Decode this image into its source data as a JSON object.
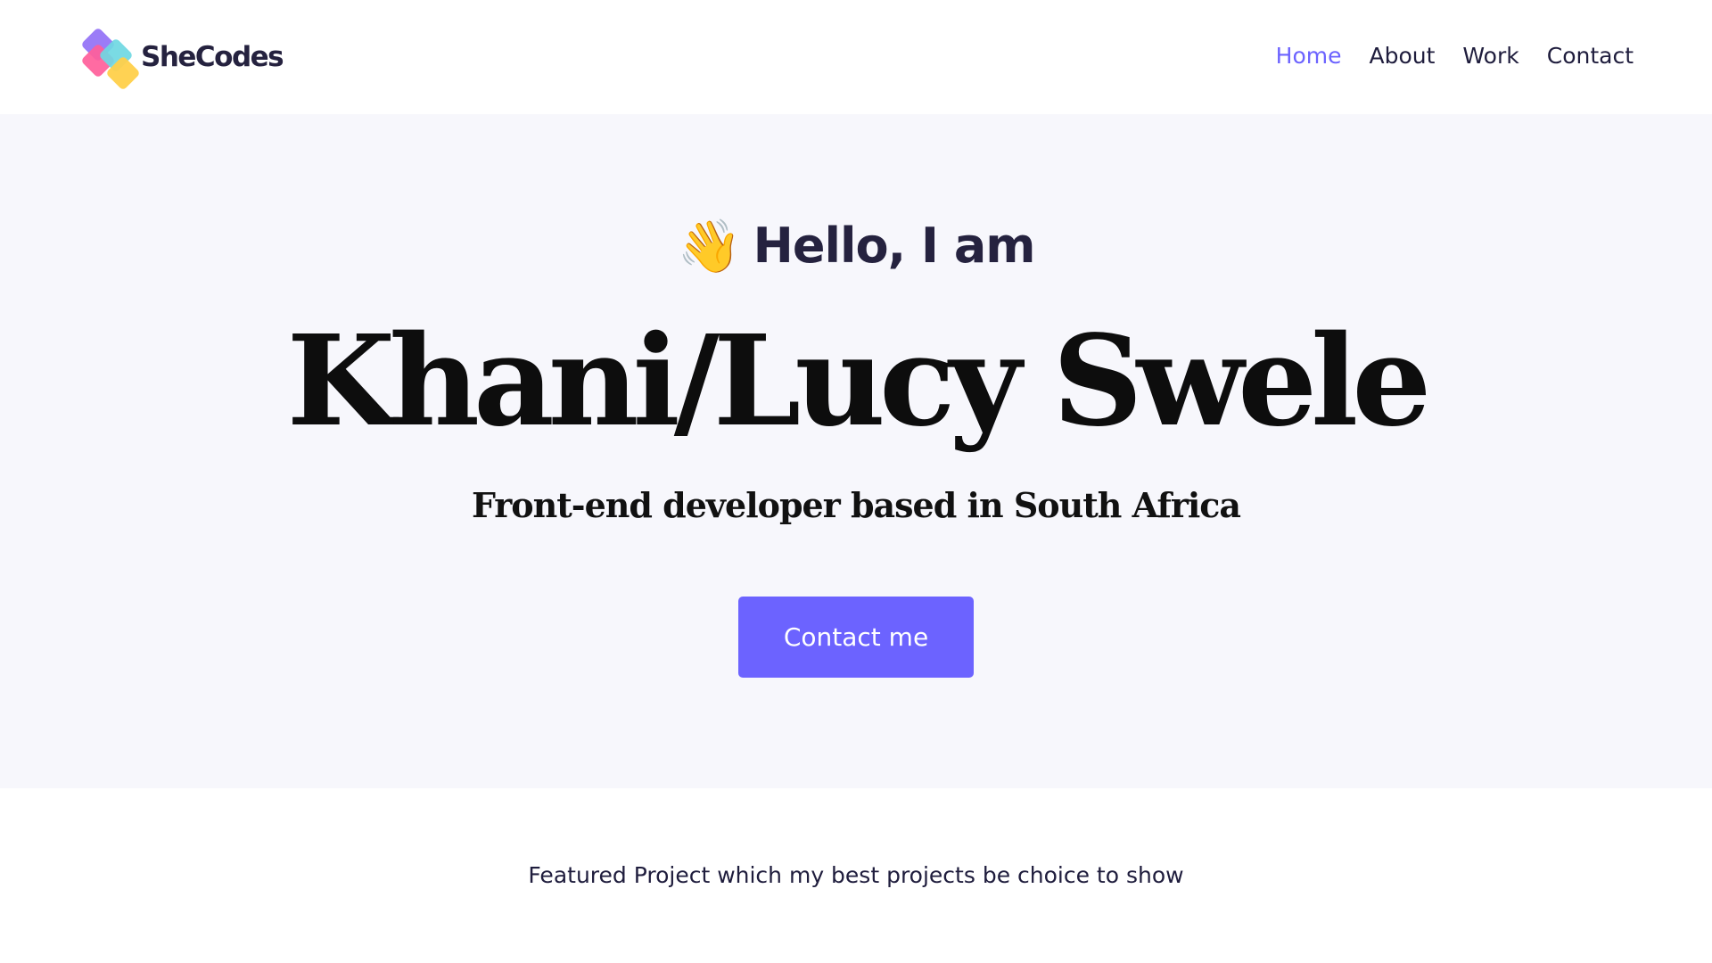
{
  "header": {
    "logo_text": "SheCodes",
    "nav": [
      {
        "label": "Home",
        "active": true
      },
      {
        "label": "About",
        "active": false
      },
      {
        "label": "Work",
        "active": false
      },
      {
        "label": "Contact",
        "active": false
      }
    ]
  },
  "hero": {
    "greeting_emoji": "👋",
    "greeting": "Hello, I am",
    "name": "Khani/Lucy Swele",
    "tagline": "Front-end developer based in South Africa",
    "cta_label": "Contact me"
  },
  "featured": {
    "text": "Featured Project which my best projects be choice to show"
  },
  "colors": {
    "accent": "#6c63ff",
    "hero_background": "#f7f7fc",
    "text_dark": "#1f1d3d"
  },
  "icons": {
    "logo": "shecodes-logo-icon",
    "greeting": "waving-hand-icon"
  }
}
